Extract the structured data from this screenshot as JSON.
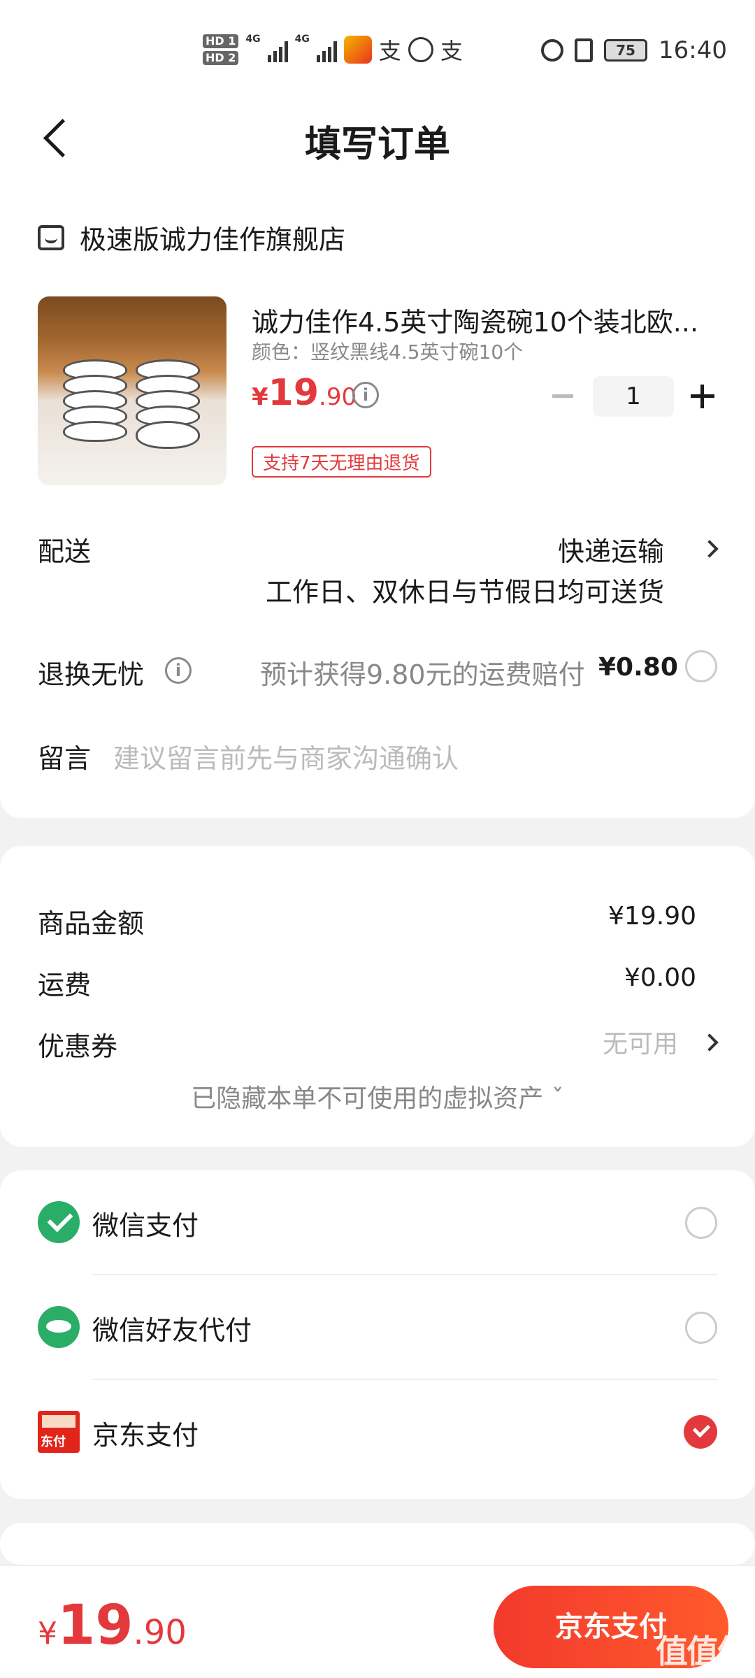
{
  "status_bar": {
    "hd1": "HD 1",
    "hd2": "HD 2",
    "net1": "4G",
    "net2": "4G",
    "zhi1": "支",
    "zhi2": "支",
    "battery": "75",
    "time": "16:40"
  },
  "header": {
    "title": "填写订单"
  },
  "store": {
    "name": "极速版诚力佳作旗舰店"
  },
  "product": {
    "name": "诚力佳作4.5英寸陶瓷碗10个装北欧...",
    "spec": "颜色：竖纹黑线4.5英寸碗10个",
    "price_currency": "¥",
    "price_int": "19",
    "price_dec": ".90",
    "quantity": "1",
    "return_tag": "支持7天无理由退货"
  },
  "delivery": {
    "label": "配送",
    "value": "快递运输",
    "sub": "工作日、双休日与节假日均可送货"
  },
  "return_insurance": {
    "label": "退换无忧",
    "text": "预计获得9.80元的运费赔付",
    "price": "¥0.80"
  },
  "message": {
    "label": "留言",
    "placeholder": "建议留言前先与商家沟通确认"
  },
  "summary": {
    "goods_label": "商品金额",
    "goods_value": "¥19.90",
    "shipping_label": "运费",
    "shipping_value": "¥0.00",
    "coupon_label": "优惠券",
    "coupon_value": "无可用",
    "hidden_assets": "已隐藏本单不可使用的虚拟资产 ˇ"
  },
  "payment_methods": [
    {
      "label": "微信支付",
      "icon": "wechat-pay-icon",
      "selected": false
    },
    {
      "label": "微信好友代付",
      "icon": "wechat-friend-pay-icon",
      "selected": false
    },
    {
      "label": "京东支付",
      "icon": "jd-pay-icon",
      "icon_text": "东付",
      "selected": true
    }
  ],
  "bottom": {
    "total_currency": "¥",
    "total_int": "19",
    "total_dec": ".90",
    "pay_button": "京东支付",
    "watermark": "值值值"
  },
  "colors": {
    "accent": "#e4393c",
    "wechat": "#2aae67"
  }
}
